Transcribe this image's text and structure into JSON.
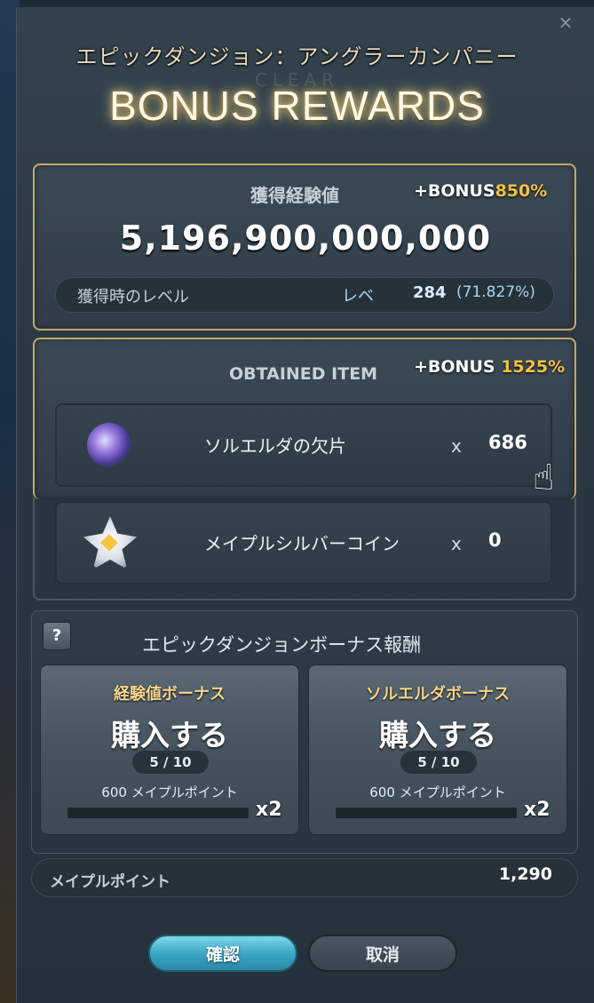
{
  "dialog": {
    "dungeon_title": "エピックダンジョン：アングラーカンパニー",
    "watermark": "CLEAR",
    "heading": "BONUS REWARDS",
    "close_glyph": "×"
  },
  "exp": {
    "label": "獲得経験値",
    "bonus_prefix": "+BONUS",
    "bonus_pct": "850%",
    "value": "5,196,900,000,000",
    "level_label": "獲得時のレベル",
    "level_word": "レベ",
    "level_num": "284",
    "level_pct": "(71.827%)"
  },
  "items": {
    "label": "OBTAINED ITEM",
    "bonus_prefix": "+BONUS",
    "bonus_pct": "1525%",
    "list": [
      {
        "name": "ソルエルダの欠片",
        "x": "x",
        "qty": "686",
        "icon": "sol-erda-fragment-icon"
      },
      {
        "name": "メイプルシルバーコイン",
        "x": "x",
        "qty": "0",
        "icon": "maple-silver-coin-icon"
      }
    ]
  },
  "epic_bonus": {
    "help": "?",
    "label": "エピックダンジョンボーナス報酬",
    "cards": [
      {
        "title": "経験値ボーナス",
        "buy": "購入する",
        "count": "5 / 10",
        "price": "600 メイプルポイント",
        "mult": "x2"
      },
      {
        "title": "ソルエルダボーナス",
        "buy": "購入する",
        "count": "5 / 10",
        "price": "600 メイプルポイント",
        "mult": "x2"
      }
    ]
  },
  "points": {
    "label": "メイプルポイント",
    "value": "1,290"
  },
  "buttons": {
    "confirm": "確認",
    "cancel": "取消"
  },
  "colors": {
    "gold_accent": "#f6c142",
    "frame_gold": "#c9a868",
    "confirm_blue": "#3ba7c4"
  }
}
